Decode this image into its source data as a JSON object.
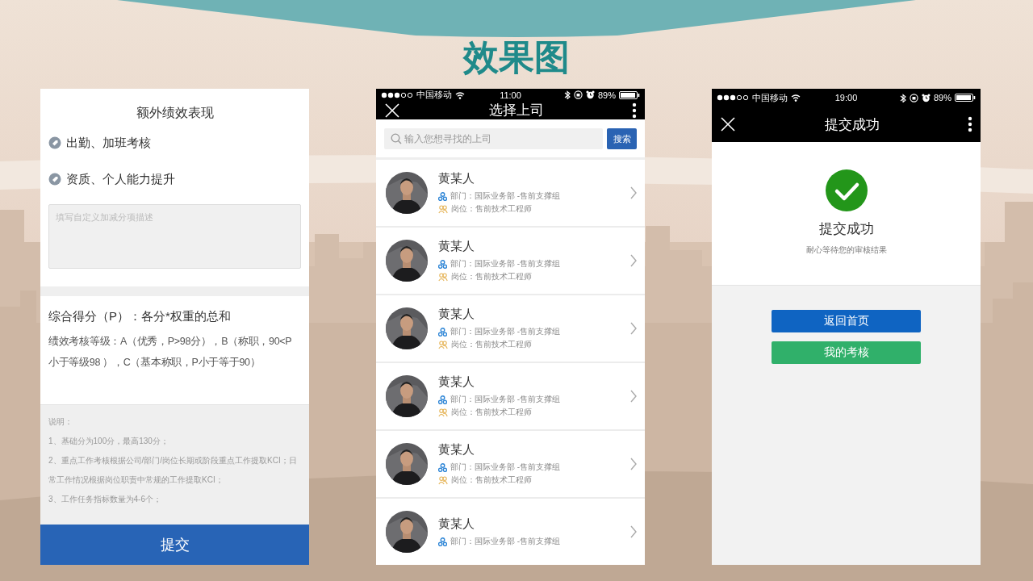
{
  "slide_title": "效果图",
  "form_screen": {
    "section_title": "额外绩效表现",
    "options": [
      {
        "label": "出勤、加班考核"
      },
      {
        "label": "资质、个人能力提升"
      }
    ],
    "description_field": {
      "placeholder": "填写自定义加减分项描述"
    },
    "score_title": "综合得分（P）：各分*权重的总和",
    "grade_text": "绩效考核等级：A（优秀，P>98分），B（称职，90<P小于等级98 ），C（基本称职，P小于等于90）",
    "notes": [
      "说明：",
      "1、基础分为100分，最高130分；",
      "2、重点工作考核根据公司/部门/岗位长期或阶段重点工作提取KCI；日常工作情况根据岗位职责中常规的工作提取KCI；",
      "3、工作任务指标数量为4-6个；"
    ],
    "submit_button": "提交"
  },
  "select_screen": {
    "status_bar": {
      "carrier": "中国移动",
      "time": "11:00",
      "battery": "89%"
    },
    "title": "选择上司",
    "search": {
      "placeholder": "输入您想寻找的上司",
      "button": "搜索"
    },
    "people": [
      {
        "name": "黄某人",
        "department": "部门：国际业务部 -售前支撑组",
        "position": "岗位：售前技术工程师"
      },
      {
        "name": "黄某人",
        "department": "部门：国际业务部 -售前支撑组",
        "position": "岗位：售前技术工程师"
      },
      {
        "name": "黄某人",
        "department": "部门：国际业务部 -售前支撑组",
        "position": "岗位：售前技术工程师"
      },
      {
        "name": "黄某人",
        "department": "部门：国际业务部 -售前支撑组",
        "position": "岗位：售前技术工程师"
      },
      {
        "name": "黄某人",
        "department": "部门：国际业务部 -售前支撑组",
        "position": "岗位：售前技术工程师"
      },
      {
        "name": "黄某人",
        "department": "部门：国际业务部 -售前支撑组"
      }
    ]
  },
  "success_screen": {
    "status_bar": {
      "carrier": "中国移动",
      "time": "19:00",
      "battery": "89%"
    },
    "title": "提交成功",
    "heading": "提交成功",
    "message": "耐心等待您的审核结果",
    "buttons": [
      {
        "label": "返回首页",
        "kind": "primary"
      },
      {
        "label": "我的考核",
        "kind": "success"
      }
    ]
  }
}
